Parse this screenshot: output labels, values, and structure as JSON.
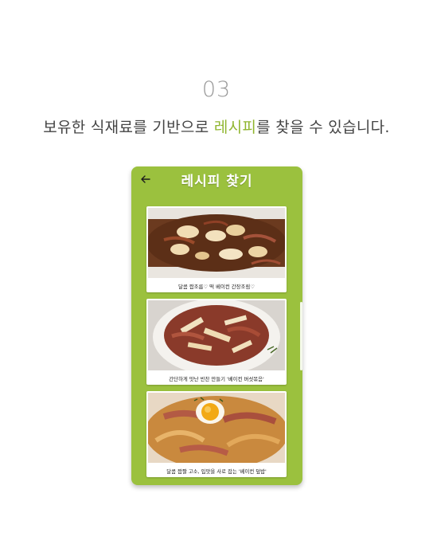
{
  "step": {
    "number": "03"
  },
  "headline": {
    "before": "보유한 식재료를 기반으로 ",
    "accent": "레시피",
    "after": "를 찾을 수 있습니다."
  },
  "app": {
    "title": "레시피 찾기",
    "back_icon": "arrow-left-icon",
    "accent_color": "#9bc13e"
  },
  "recipes": [
    {
      "caption": "달콤 짭조름♡ 떡 베이컨 간장조림♡"
    },
    {
      "caption": "간단하게 맛난 반찬 만들기 '베이컨 버섯볶음'"
    },
    {
      "caption": "달콤 짭짤 고소, 입맛을 사로 잡는 '베이컨 덮밥'"
    }
  ]
}
